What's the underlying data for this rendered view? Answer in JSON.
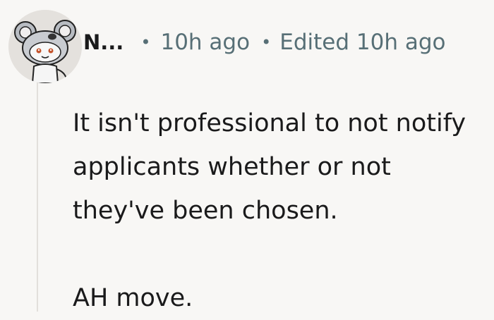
{
  "comment": {
    "author": "N...",
    "timestamp": "10h ago",
    "edited": "Edited 10h ago",
    "separator": "•",
    "avatar_icon": "snoo-koala-avatar-icon",
    "paragraphs": [
      "It isn't professional to not notify applicants whether or not they've been chosen.",
      "AH move."
    ]
  },
  "colors": {
    "background": "#f8f7f5",
    "text": "#1a1a1b",
    "meta": "#576f76",
    "thread_line": "#e2dfdb"
  }
}
